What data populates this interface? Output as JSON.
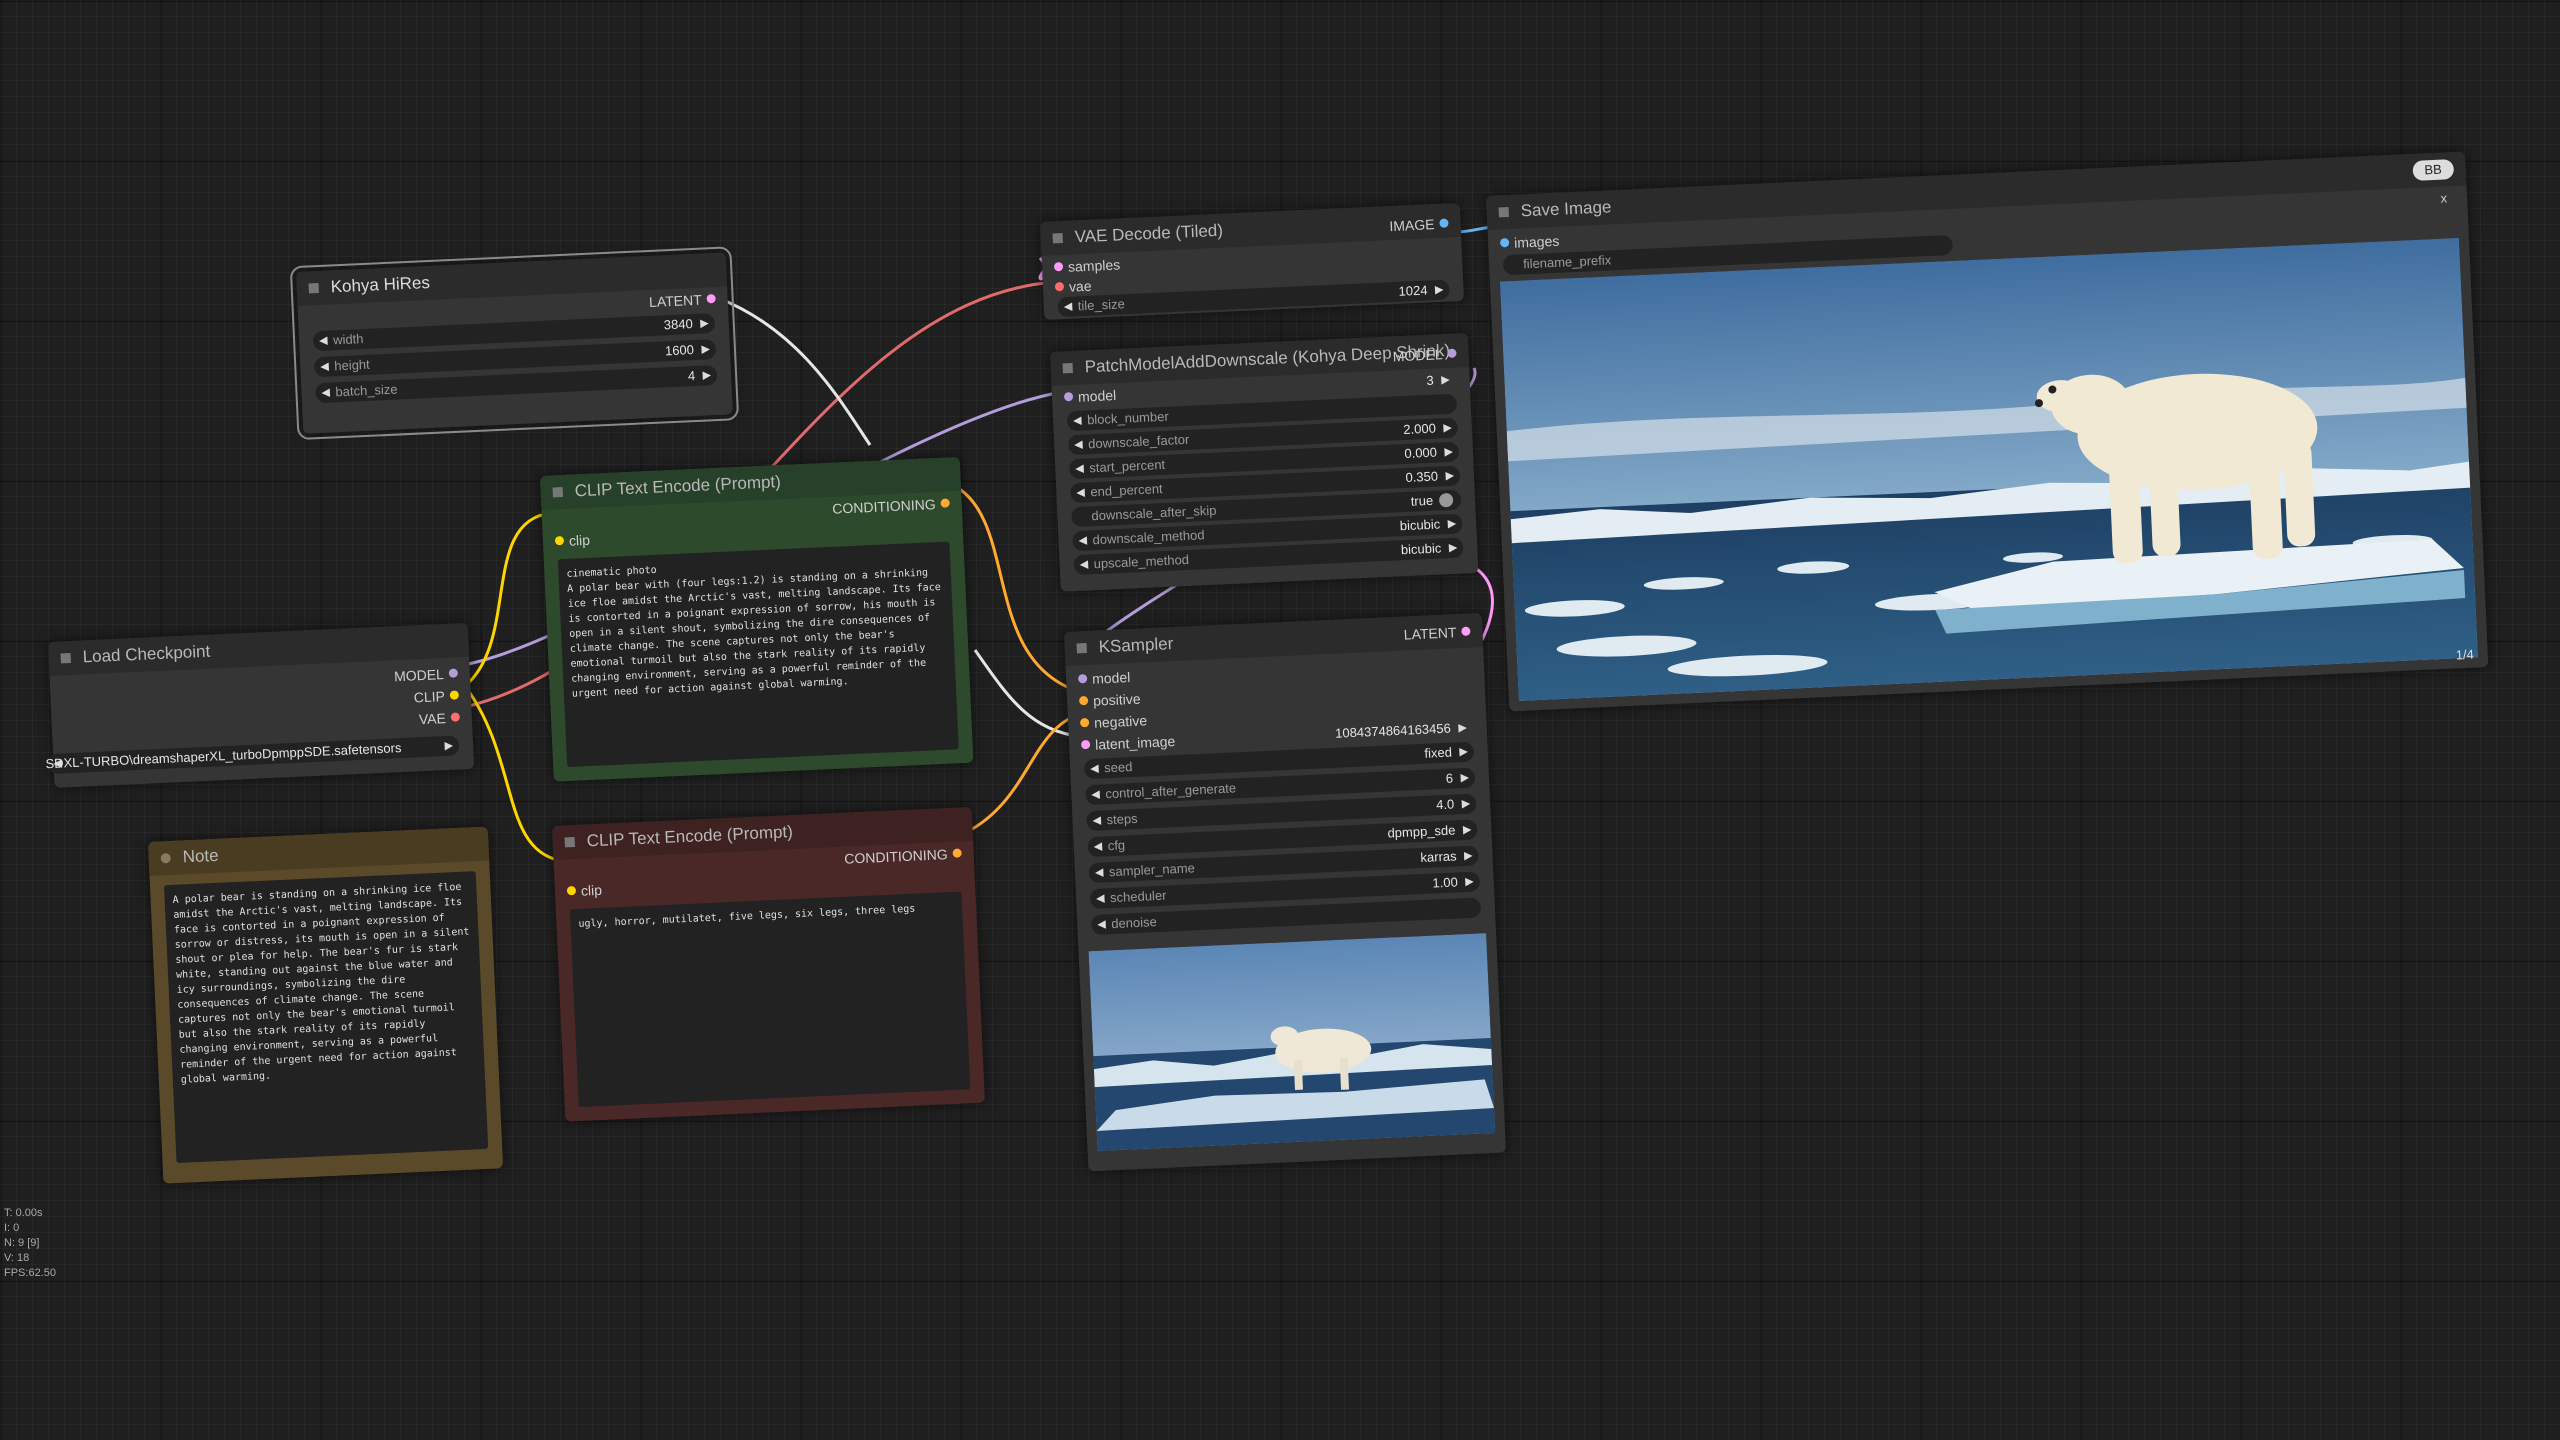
{
  "nodes": {
    "kohya": {
      "title": "Kohya HiRes",
      "out_latent": "LATENT",
      "width": {
        "name": "width",
        "value": "3840"
      },
      "height": {
        "name": "height",
        "value": "1600"
      },
      "batch": {
        "name": "batch_size",
        "value": "4"
      }
    },
    "checkpoint": {
      "title": "Load Checkpoint",
      "out_model": "MODEL",
      "out_clip": "CLIP",
      "out_vae": "VAE",
      "ckpt_name": "SDXL-TURBO\\dreamshaperXL_turboDpmppSDE.safetensors"
    },
    "note": {
      "title": "Note",
      "text": "A polar bear is standing on a shrinking ice floe amidst the Arctic's vast, melting landscape. Its face is contorted in a poignant expression of sorrow or distress, its mouth is open in a silent shout or plea for help. The bear's fur is stark white, standing out against the blue water and icy surroundings, symbolizing the dire consequences of climate change. The scene captures not only the bear's emotional turmoil but also the stark reality of its rapidly changing environment, serving as a powerful reminder of the urgent need for action against global warming."
    },
    "clip_pos": {
      "title": "CLIP Text Encode (Prompt)",
      "in_clip": "clip",
      "out": "CONDITIONING",
      "text": "cinematic photo\nA polar bear with (four legs:1.2) is standing on a shrinking ice floe amidst the Arctic's vast, melting landscape. Its face is contorted in a poignant expression of sorrow, his mouth is open in a silent shout, symbolizing the dire consequences of climate change. The scene captures not only the bear's emotional turmoil but also the stark reality of its rapidly changing environment, serving as a powerful reminder of the urgent need for action against global warming."
    },
    "clip_neg": {
      "title": "CLIP Text Encode (Prompt)",
      "in_clip": "clip",
      "out": "CONDITIONING",
      "text": "ugly, horror, mutilatet, five legs, six legs, three legs"
    },
    "vae_decode": {
      "title": "VAE Decode (Tiled)",
      "in_samples": "samples",
      "in_vae": "vae",
      "out": "IMAGE",
      "tile": {
        "name": "tile_size",
        "value": "1024"
      }
    },
    "patch": {
      "title": "PatchModelAddDownscale (Kohya Deep Shrink)",
      "in_model": "model",
      "out": "MODEL",
      "widgets": [
        {
          "name": "block_number",
          "value": "3"
        },
        {
          "name": "downscale_factor",
          "value": "2.000"
        },
        {
          "name": "start_percent",
          "value": "0.000"
        },
        {
          "name": "end_percent",
          "value": "0.350"
        },
        {
          "name": "downscale_after_skip",
          "value": "true"
        },
        {
          "name": "downscale_method",
          "value": "bicubic"
        },
        {
          "name": "upscale_method",
          "value": "bicubic"
        }
      ]
    },
    "ksampler": {
      "title": "KSampler",
      "in_model": "model",
      "in_positive": "positive",
      "in_negative": "negative",
      "in_latent": "latent_image",
      "out": "LATENT",
      "widgets": [
        {
          "name": "seed",
          "value": "1084374864163456"
        },
        {
          "name": "control_after_generate",
          "value": "fixed"
        },
        {
          "name": "steps",
          "value": "6"
        },
        {
          "name": "cfg",
          "value": "4.0"
        },
        {
          "name": "sampler_name",
          "value": "dpmpp_sde"
        },
        {
          "name": "scheduler",
          "value": "karras"
        },
        {
          "name": "denoise",
          "value": "1.00"
        }
      ]
    },
    "save": {
      "title": "Save Image",
      "badge": "BB",
      "in_images": "images",
      "prefix_label": "filename_prefix",
      "close": "x",
      "counter": "1/4"
    }
  },
  "status": [
    "T: 0.00s",
    "I: 0",
    "N: 9 [9]",
    "V: 18",
    "FPS:62.50"
  ],
  "colors": {
    "model": "#b39ddb",
    "clip": "#ffd500",
    "vae": "#ff6e6e",
    "latent": "#ff9cf9",
    "conditioning": "#ffa931",
    "image": "#64b5f6",
    "pos_node": "#2d4a2d",
    "neg_node": "#4a2828",
    "note_node": "#5a4a2a"
  }
}
